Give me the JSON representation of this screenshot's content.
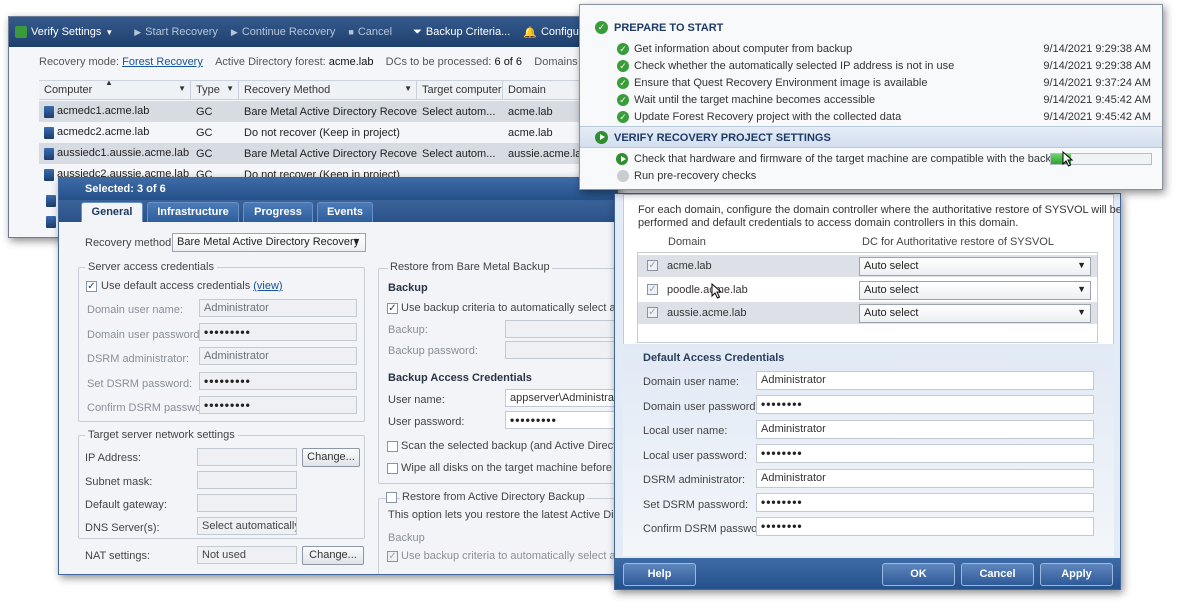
{
  "toolbar": {
    "verify_settings": "Verify Settings",
    "start_recovery": "Start Recovery",
    "continue_recovery": "Continue Recovery",
    "cancel": "Cancel",
    "backup_criteria": "Backup Criteria...",
    "configure_alerts": "Configure Alerts..."
  },
  "info_bar": {
    "recovery_mode_label": "Recovery mode:",
    "recovery_mode_value": "Forest Recovery",
    "forest_label": "Active Directory forest:",
    "forest_value": "acme.lab",
    "dcs_label": "DCs to be processed:",
    "dcs_value": "6 of 6",
    "domains_label": "Domains to be pro"
  },
  "grid": {
    "columns": [
      "Computer",
      "Type",
      "Recovery Method",
      "Target computer",
      "Domain"
    ],
    "rows": [
      {
        "computer": "acmedc1.acme.lab",
        "type": "GC",
        "method": "Bare Metal Active Directory Recovery",
        "target": "Select autom...",
        "domain": "acme.lab"
      },
      {
        "computer": "acmedc2.acme.lab",
        "type": "GC",
        "method": "Do not recover (Keep in project)",
        "target": "",
        "domain": "acme.lab"
      },
      {
        "computer": "aussiedc1.aussie.acme.lab",
        "type": "GC",
        "method": "Bare Metal Active Directory Recovery",
        "target": "Select autom...",
        "domain": "aussie.acme.lab"
      },
      {
        "computer": "aussiedc2.aussie.acme.lab",
        "type": "GC",
        "method": "Do not recover (Keep in project)",
        "target": "",
        "domain": ""
      }
    ]
  },
  "dialog": {
    "title": "Selected: 3 of 6",
    "tabs": [
      "General",
      "Infrastructure",
      "Progress",
      "Events"
    ],
    "recovery_method_label": "Recovery method:",
    "recovery_method_value": "Bare Metal Active Directory Recovery",
    "server_access": {
      "title": "Server access credentials",
      "use_default": "Use default access credentials",
      "view_link": "(view)",
      "domain_user_label": "Domain user name:",
      "domain_user_value": "Administrator",
      "domain_password_label": "Domain user password:",
      "dsrm_admin_label": "DSRM administrator:",
      "dsrm_admin_value": "Administrator",
      "set_dsrm_label": "Set DSRM password:",
      "confirm_dsrm_label": "Confirm DSRM passwor",
      "mask": "•••••••••"
    },
    "network": {
      "title": "Target server network settings",
      "ip_label": "IP Address:",
      "subnet_label": "Subnet mask:",
      "gateway_label": "Default gateway:",
      "dns_label": "DNS Server(s):",
      "dns_value": "Select automatically",
      "change_label": "Change..."
    },
    "nat": {
      "label": "NAT settings:",
      "value": "Not used",
      "change_label": "Change..."
    },
    "restore_bmb": {
      "title": "Restore from Bare Metal Backup",
      "backup_heading": "Backup",
      "use_criteria": "Use backup criteria to automatically select a ba",
      "backup_label": "Backup:",
      "backup_password_label": "Backup password:",
      "access_heading": "Backup Access Credentials",
      "user_name_label": "User name:",
      "user_name_value": "appserver\\Administrato",
      "user_password_label": "User password:",
      "mask": "•••••••••",
      "scan_label": "Scan the selected backup (and Active Directory",
      "wipe_label": "Wipe all disks on the target machine before res"
    },
    "restore_ad": {
      "title": "Restore from Active Directory Backup",
      "desc": "This option lets you restore the latest Active Direct",
      "backup_heading": "Backup",
      "use_criteria": "Use backup criteria to automatically select a ba"
    }
  },
  "sysvol_dialog": {
    "desc_line1": "For each domain, configure the domain controller where the authoritative restore of SYSVOL will be",
    "desc_line2": "performed and default credentials to access domain controllers in this domain.",
    "col_domain": "Domain",
    "col_dc": "DC for Authoritative restore of SYSVOL",
    "rows": [
      {
        "domain": "acme.lab",
        "dc": "Auto select"
      },
      {
        "domain": "poodle.acme.lab",
        "dc": "Auto select"
      },
      {
        "domain": "aussie.acme.lab",
        "dc": "Auto select"
      }
    ],
    "creds_heading": "Default Access Credentials",
    "domain_user_label": "Domain user name:",
    "domain_user_value": "Administrator",
    "domain_password_label": "Domain user password:",
    "local_user_label": "Local user name:",
    "local_user_value": "Administrator",
    "local_password_label": "Local user password:",
    "dsrm_admin_label": "DSRM administrator:",
    "dsrm_admin_value": "Administrator",
    "set_dsrm_label": "Set DSRM password:",
    "confirm_dsrm_label": "Confirm DSRM passwor",
    "mask": "••••••••",
    "help": "Help",
    "ok": "OK",
    "cancel": "Cancel",
    "apply": "Apply"
  },
  "progress": {
    "section1": "PREPARE TO START",
    "steps1": [
      {
        "text": "Get information about computer from backup",
        "time": "9/14/2021 9:29:38 AM"
      },
      {
        "text": "Check whether the automatically selected IP address is not in use",
        "time": "9/14/2021 9:29:38 AM"
      },
      {
        "text": "Ensure that Quest Recovery Environment image is available",
        "time": "9/14/2021 9:37:24 AM"
      },
      {
        "text": "Wait until the target machine becomes accessible",
        "time": "9/14/2021 9:45:42 AM"
      },
      {
        "text": "Update Forest Recovery project with the collected data",
        "time": "9/14/2021 9:45:42 AM"
      }
    ],
    "section2": "VERIFY RECOVERY PROJECT SETTINGS",
    "current_step": "Check that hardware and firmware of the target machine are compatible with the backup",
    "current_progress": 0.2,
    "pending_step": "Run pre-recovery checks"
  }
}
